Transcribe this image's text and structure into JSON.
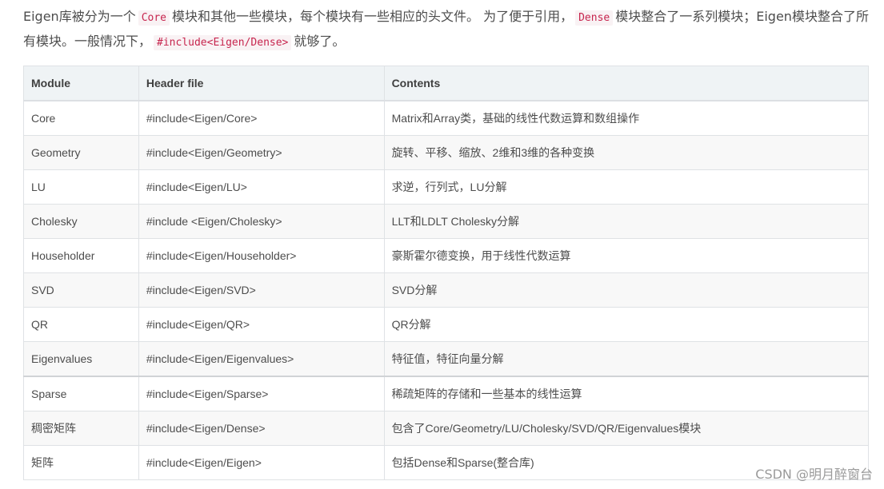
{
  "intro": {
    "part1": "Eigen库被分为一个",
    "code1": "Core",
    "part2": "模块和其他一些模块，每个模块有一些相应的头文件。 为了便于引用，",
    "code2": "Dense",
    "part3": "模块整合了一系列模块；Eigen模块整合了所有模块。一般情况下，",
    "code3": "#include<Eigen/Dense>",
    "part4": "就够了。"
  },
  "table": {
    "headers": [
      "Module",
      "Header file",
      "Contents"
    ],
    "rows": [
      [
        "Core",
        "#include<Eigen/Core>",
        "Matrix和Array类，基础的线性代数运算和数组操作"
      ],
      [
        "Geometry",
        "#include<Eigen/Geometry>",
        "旋转、平移、缩放、2维和3维的各种变换"
      ],
      [
        "LU",
        "#include<Eigen/LU>",
        "求逆，行列式，LU分解"
      ],
      [
        "Cholesky",
        "#include <Eigen/Cholesky>",
        "LLT和LDLT Cholesky分解"
      ],
      [
        "Householder",
        "#include<Eigen/Householder>",
        "豪斯霍尔德变换，用于线性代数运算"
      ],
      [
        "SVD",
        "#include<Eigen/SVD>",
        "SVD分解"
      ],
      [
        "QR",
        "#include<Eigen/QR>",
        "QR分解"
      ],
      [
        "Eigenvalues",
        "#include<Eigen/Eigenvalues>",
        "特征值，特征向量分解"
      ],
      [
        "Sparse",
        "#include<Eigen/Sparse>",
        "稀疏矩阵的存储和一些基本的线性运算"
      ],
      [
        "稠密矩阵",
        "#include<Eigen/Dense>",
        "包含了Core/Geometry/LU/Cholesky/SVD/QR/Eigenvalues模块"
      ],
      [
        "矩阵",
        "#include<Eigen/Eigen>",
        "包括Dense和Sparse(整合库)"
      ]
    ]
  },
  "watermark": "CSDN @明月醉窗台"
}
